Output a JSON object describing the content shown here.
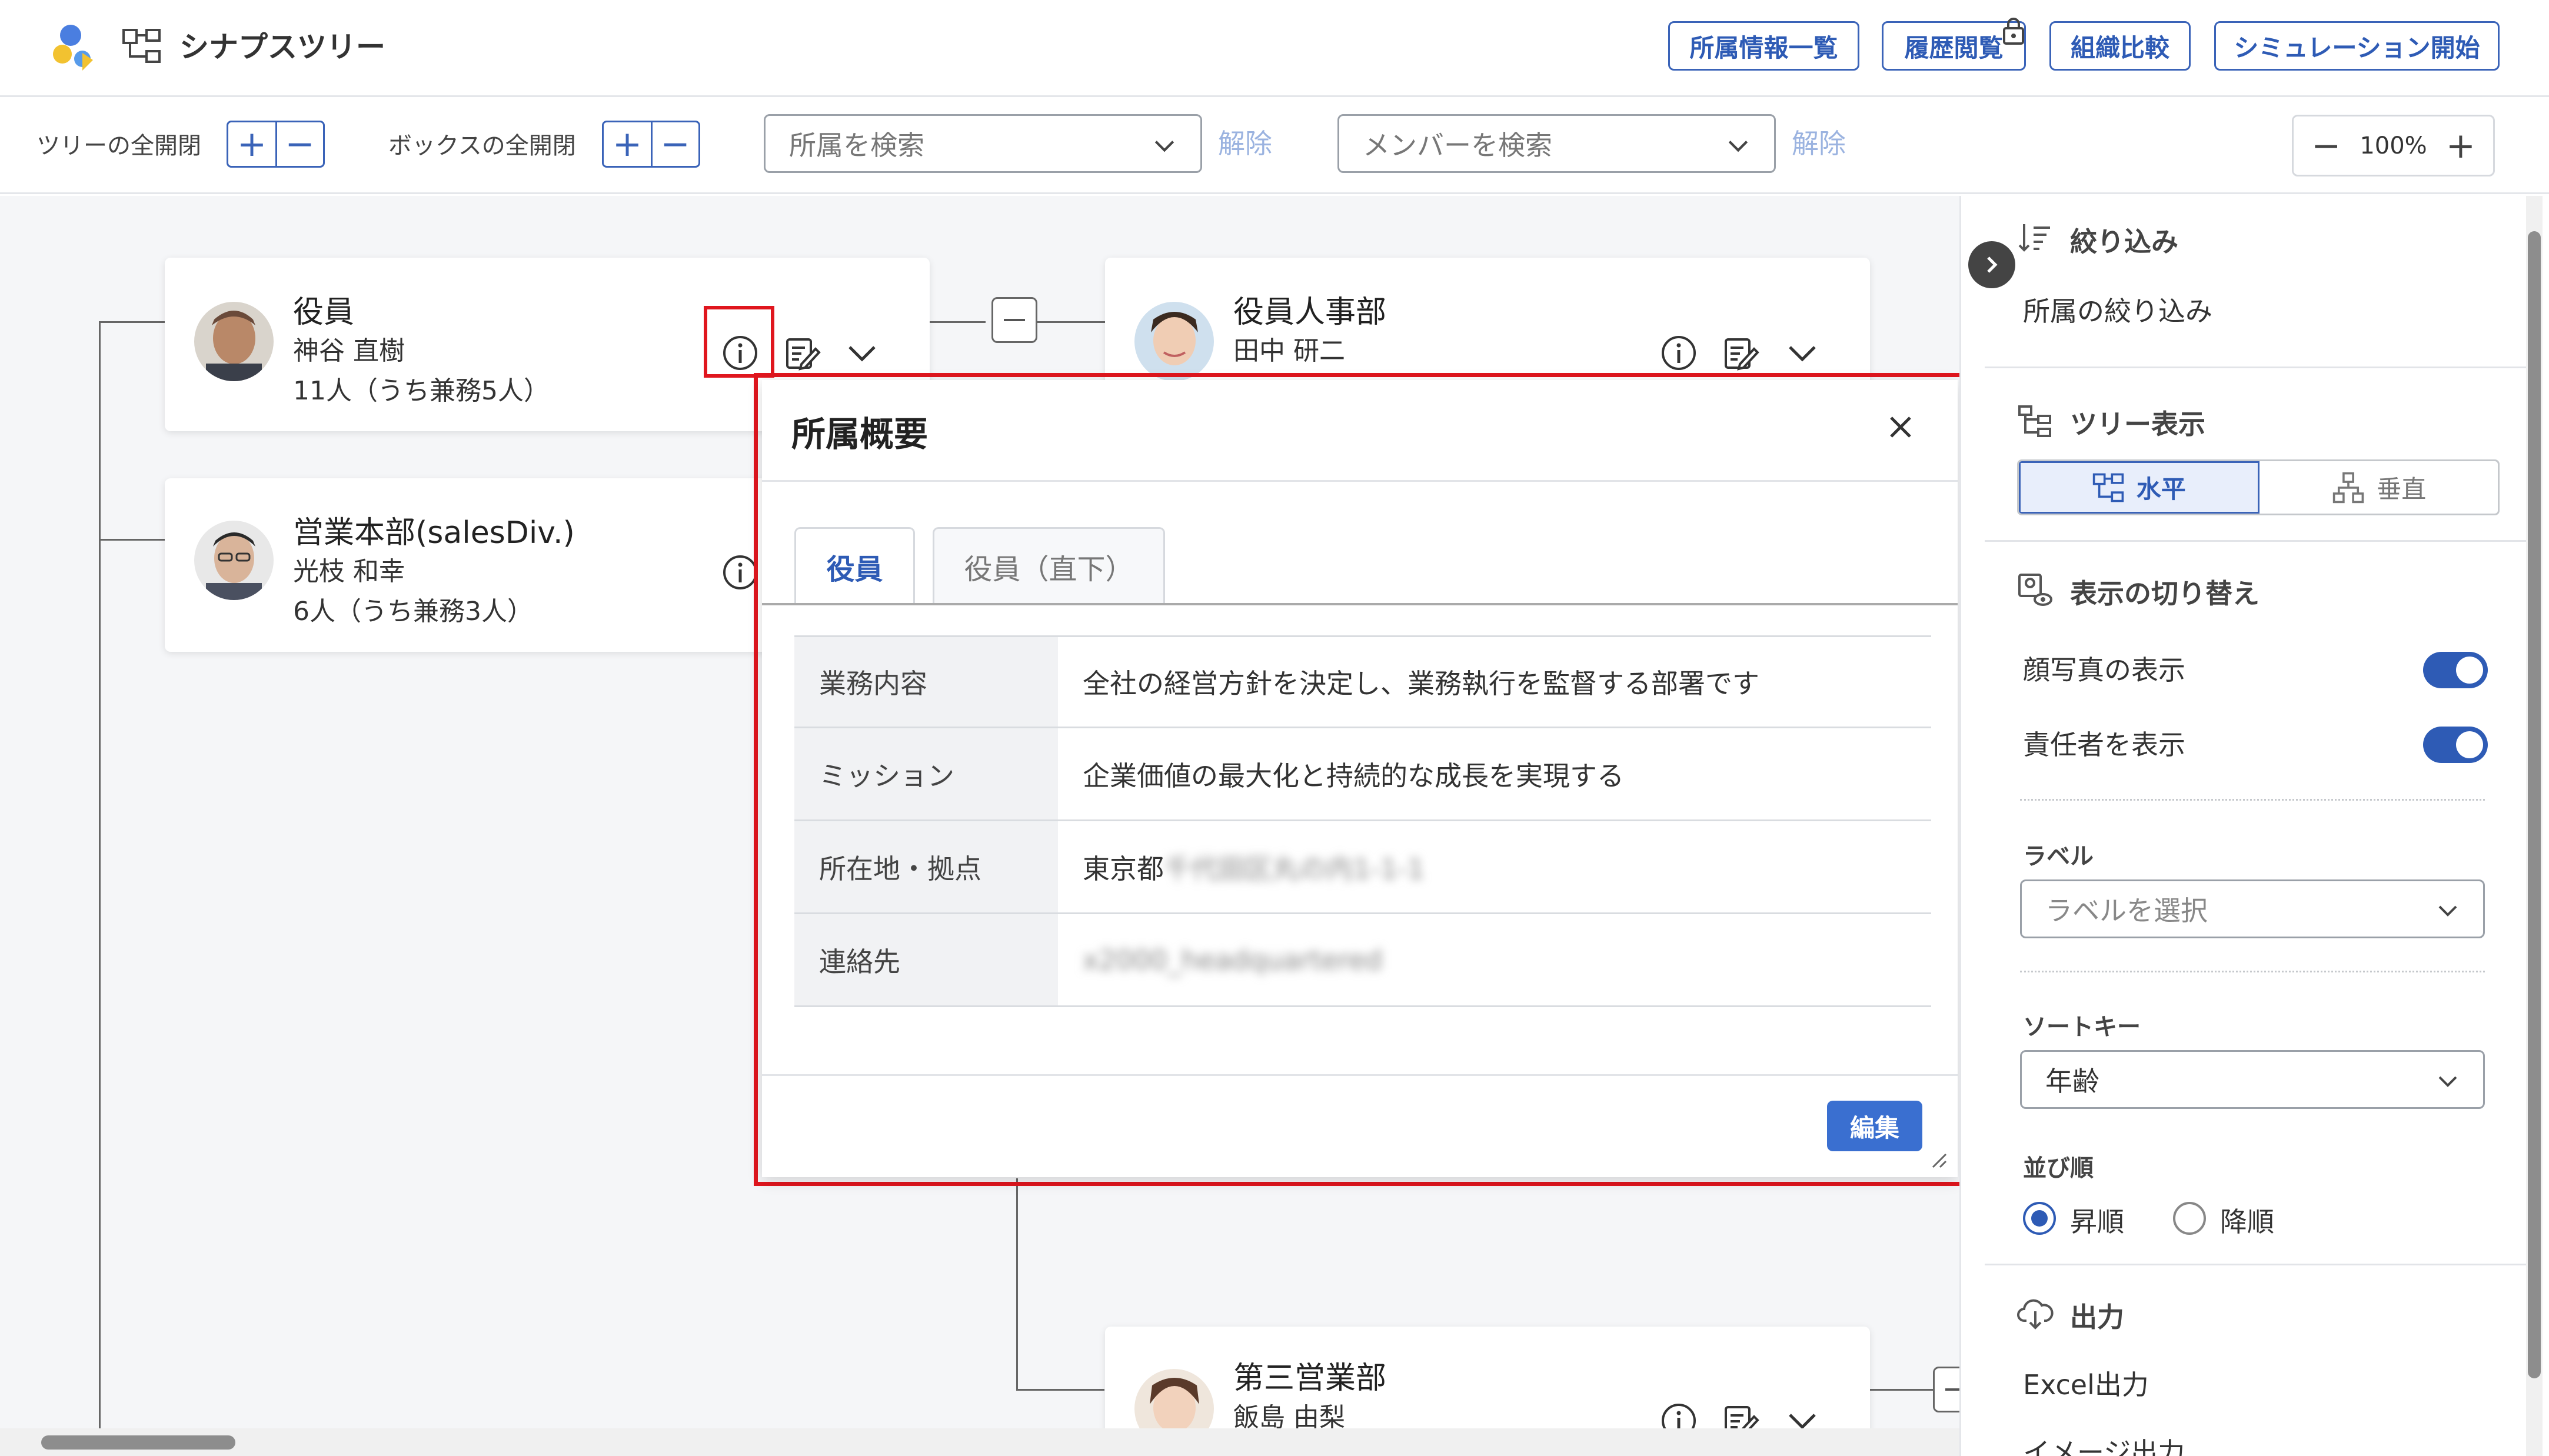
{
  "header": {
    "app_title": "シナプスツリー",
    "buttons": [
      "所属情報一覧",
      "履歴閲覧",
      "組織比較",
      "シミュレーション開始"
    ]
  },
  "toolbar": {
    "tree_expand_label": "ツリーの全開閉",
    "box_expand_label": "ボックスの全開閉",
    "plus": "+",
    "minus": "−",
    "dept_search_placeholder": "所属を検索",
    "member_search_placeholder": "メンバーを検索",
    "clear_label": "解除",
    "zoom": "100%",
    "zoom_minus": "−",
    "zoom_plus": "+"
  },
  "tree": {
    "cards": [
      {
        "title": "役員",
        "manager": "神谷 直樹",
        "count": "11人（うち兼務5人）"
      },
      {
        "title": "営業本部(salesDiv.)",
        "manager": "光枝 和幸",
        "count": "6人（うち兼務3人）"
      },
      {
        "title": "役員人事部",
        "manager": "田中 研二",
        "count": ""
      },
      {
        "title": "第三営業部",
        "manager": "飯島 由梨",
        "count": ""
      }
    ]
  },
  "modal": {
    "title": "所属概要",
    "tabs": [
      "役員",
      "役員（直下）"
    ],
    "rows": [
      {
        "key": "業務内容",
        "value": "全社の経営方針を決定し、業務執行を監督する部署です"
      },
      {
        "key": "ミッション",
        "value": "企業価値の最大化と持続的な成長を実現する"
      },
      {
        "key": "所在地・拠点",
        "value": "東京都",
        "blurred": "千代田区丸の内1-1-1"
      },
      {
        "key": "連絡先",
        "value": "",
        "blurred": "x2000_headquartered"
      }
    ],
    "edit_label": "編集"
  },
  "panel": {
    "filter_title": "絞り込み",
    "filter_item": "所属の絞り込み",
    "tree_view_title": "ツリー表示",
    "tree_view_horizontal": "水平",
    "tree_view_vertical": "垂直",
    "display_title": "表示の切り替え",
    "show_photo": "顔写真の表示",
    "show_manager": "責任者を表示",
    "label_title": "ラベル",
    "label_placeholder": "ラベルを選択",
    "sort_key_title": "ソートキー",
    "sort_key_value": "年齢",
    "order_title": "並び順",
    "order_asc": "昇順",
    "order_desc": "降順",
    "output_title": "出力",
    "output_excel": "Excel出力",
    "output_image": "イメージ出力"
  },
  "colors": {
    "accent": "#2e5bb5",
    "highlight": "#e0161e",
    "edit_button": "#3a6fd0"
  }
}
